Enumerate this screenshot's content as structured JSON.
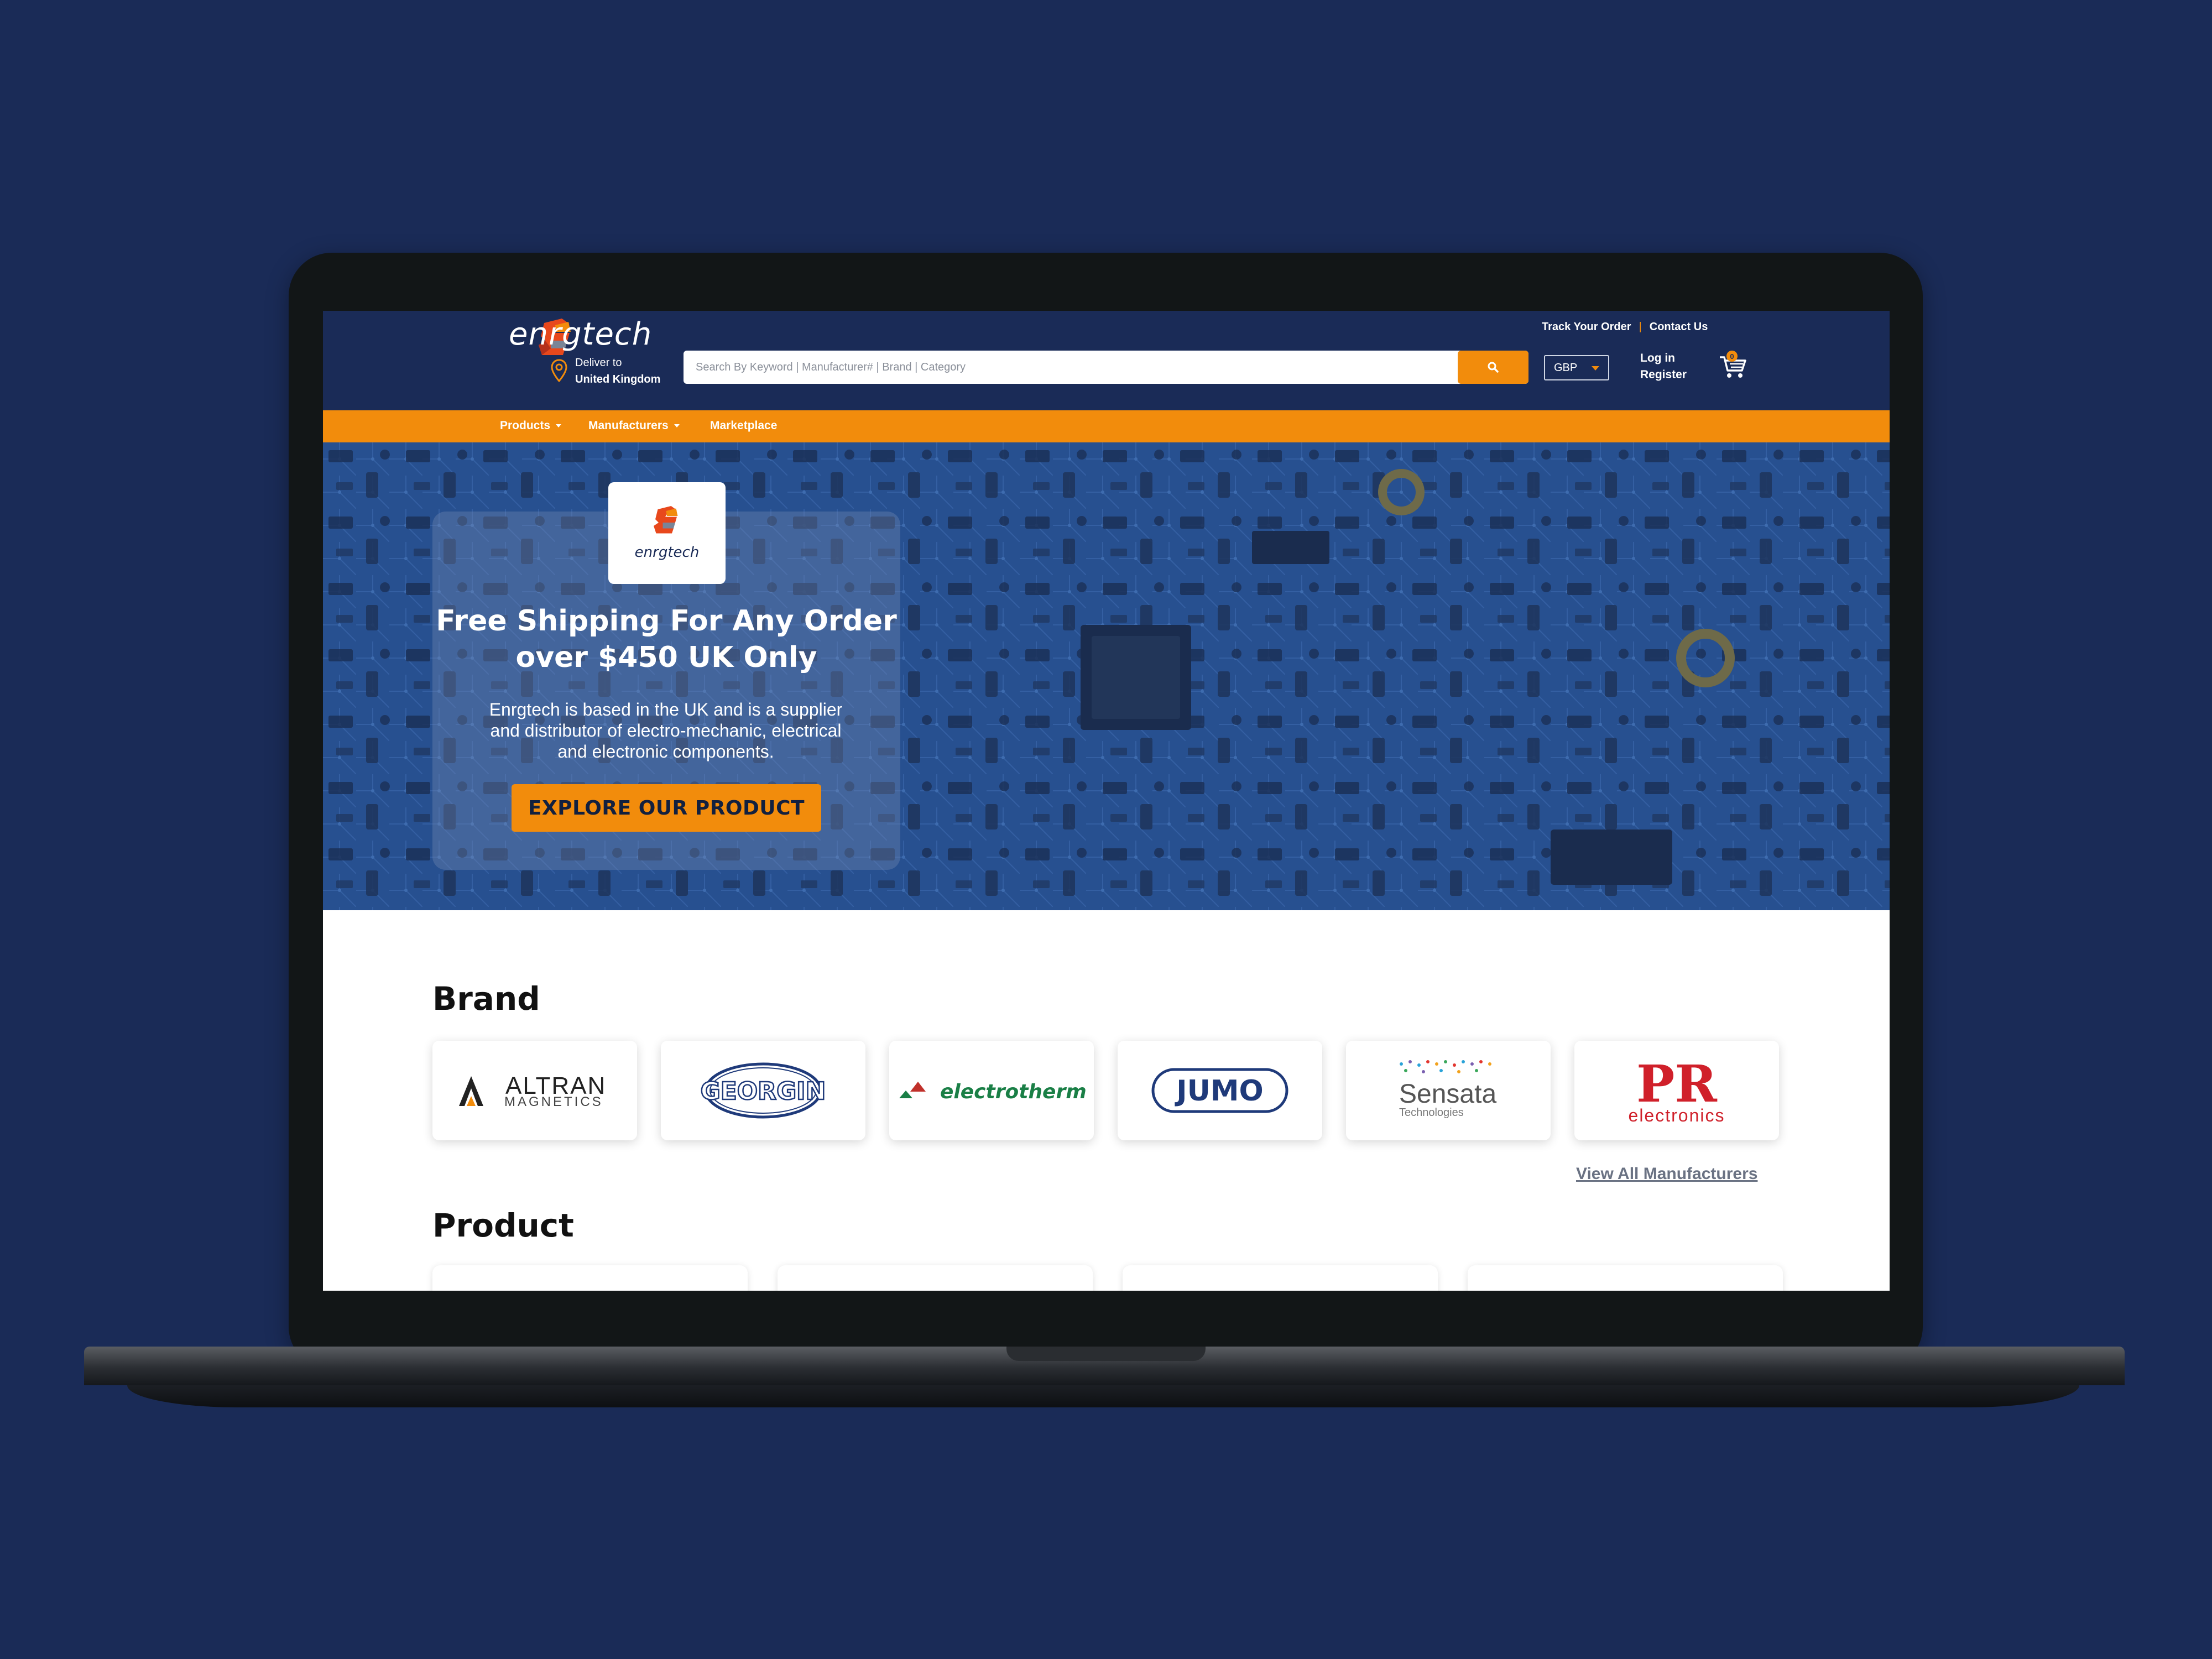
{
  "header": {
    "logo_text": "enrgtech",
    "deliver_label": "Deliver to",
    "deliver_location": "United Kingdom",
    "search_placeholder": "Search By Keyword | Manufacturer# | Brand | Category",
    "currency": "GBP",
    "login_label": "Log in",
    "register_label": "Register",
    "cart_count": "0",
    "track_order_label": "Track Your Order",
    "contact_label": "Contact Us"
  },
  "nav": {
    "items": [
      {
        "label": "Products",
        "dropdown": true
      },
      {
        "label": "Manufacturers",
        "dropdown": true
      },
      {
        "label": "Marketplace",
        "dropdown": false
      }
    ]
  },
  "hero": {
    "logo_text": "enrgtech",
    "title_line1": "Free Shipping For Any Order",
    "title_line2": "over $450 UK Only",
    "description_line1": "Enrgtech is based in the UK and is a supplier",
    "description_line2": "and distributor of electro-mechanic, electrical",
    "description_line3": "and electronic components.",
    "cta_label": "EXPLORE OUR PRODUCT"
  },
  "brand_section": {
    "title": "Brand",
    "brands": [
      {
        "name": "ALTRAN",
        "subtitle": "MAGNETICS"
      },
      {
        "name": "GEORGIN"
      },
      {
        "name": "electrotherm"
      },
      {
        "name": "JUMO"
      },
      {
        "name": "Sensata",
        "subtitle": "Technologies"
      },
      {
        "name": "PR",
        "subtitle": "electronics"
      }
    ],
    "view_all_label": "View All Manufacturers"
  },
  "product_section": {
    "title": "Product"
  },
  "colors": {
    "primary_navy": "#1a2b57",
    "accent_orange": "#f28c0c",
    "background": "#1a2b57"
  }
}
